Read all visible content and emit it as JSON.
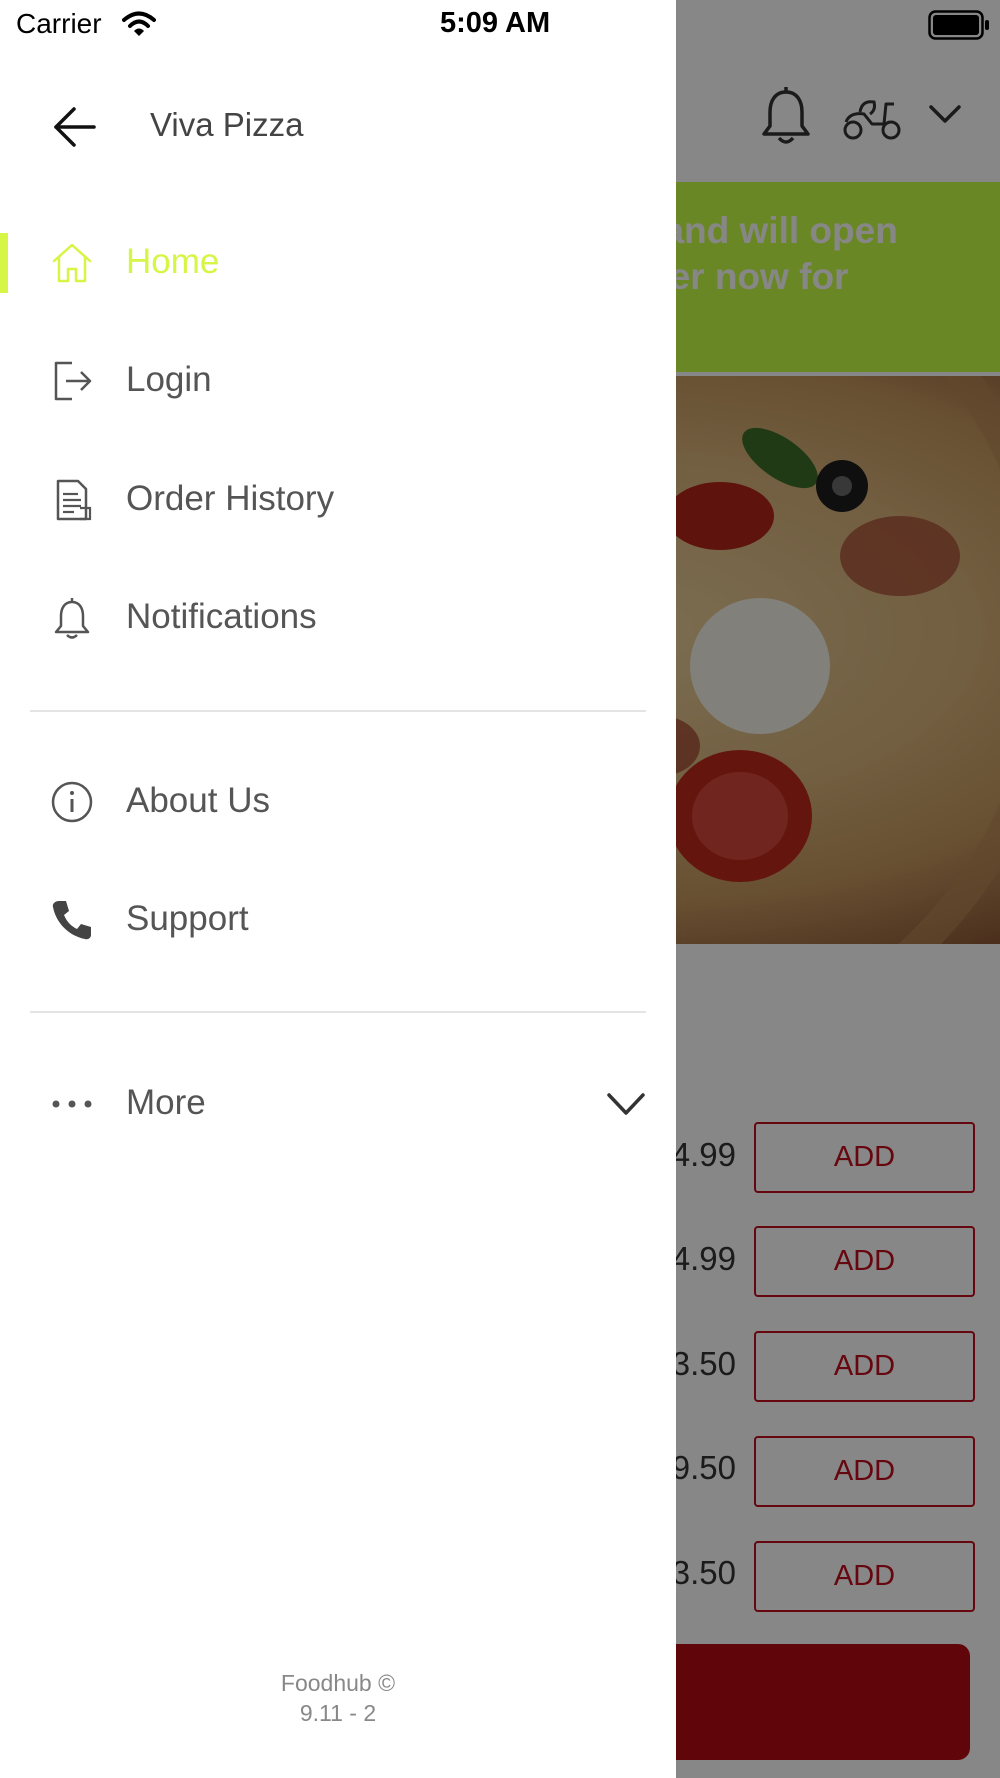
{
  "status_bar": {
    "carrier": "Carrier",
    "time": "5:09 AM"
  },
  "drawer": {
    "restaurant_name": "Viva Pizza",
    "items": [
      {
        "label": "Home",
        "icon": "home-icon",
        "active": true
      },
      {
        "label": "Login",
        "icon": "login-icon"
      },
      {
        "label": "Order History",
        "icon": "order-history-icon"
      },
      {
        "label": "Notifications",
        "icon": "bell-icon"
      },
      {
        "label": "About Us",
        "icon": "info-icon"
      },
      {
        "label": "Support",
        "icon": "phone-icon"
      },
      {
        "label": "More",
        "icon": "more-dots-icon"
      }
    ],
    "footer": {
      "brand": "Foodhub ©",
      "version": "9.11 - 2"
    }
  },
  "background": {
    "banner_line1": "ed and will open",
    "banner_line2": "order now for",
    "prices": [
      ".99",
      ".99",
      ".50",
      ".50",
      ".50"
    ],
    "price_digits": [
      "4",
      "4",
      "3",
      "9",
      "3"
    ],
    "add_label": "ADD"
  },
  "colors": {
    "accent": "#d6f545",
    "banner": "#c8ff47",
    "brand_red": "#c10d1e"
  }
}
